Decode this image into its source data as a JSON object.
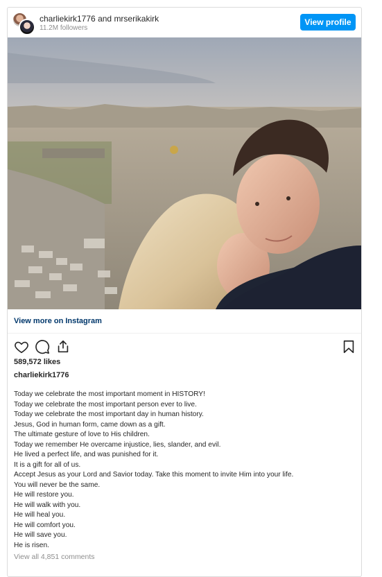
{
  "header": {
    "user1": "charliekirk1776",
    "joiner": "and",
    "user2": "mrserikakirk",
    "followers": "11.2M followers",
    "view_profile_label": "View profile"
  },
  "post": {
    "view_more_label": "View more on Instagram",
    "likes": "589,572 likes",
    "author": "charliekirk1776",
    "caption_lines": [
      "Today we celebrate the most important moment in HISTORY!",
      "Today we celebrate the most important person ever to live.",
      "Today we celebrate the most important day in human history.",
      "Jesus, God in human form, came down as a gift.",
      "The ultimate gesture of love to His children.",
      "Today we remember He overcame injustice, lies, slander, and evil.",
      "He lived a perfect life, and was punished for it.",
      "It is a gift for all of us.",
      "Accept Jesus as your Lord and Savior today. Take this moment to invite Him into your life.",
      "You will never be the same.",
      "He will restore you.",
      "He will walk with you.",
      "He will heal you.",
      "He will comfort you.",
      "He will save you.",
      "He is risen."
    ],
    "comments_label": "View all 4,851 comments"
  },
  "icons": {
    "like": "heart-icon",
    "comment": "comment-icon",
    "share": "share-icon",
    "save": "bookmark-icon"
  },
  "colors": {
    "accent": "#0095f6",
    "link": "#00376b",
    "muted": "#8e8e8e"
  }
}
